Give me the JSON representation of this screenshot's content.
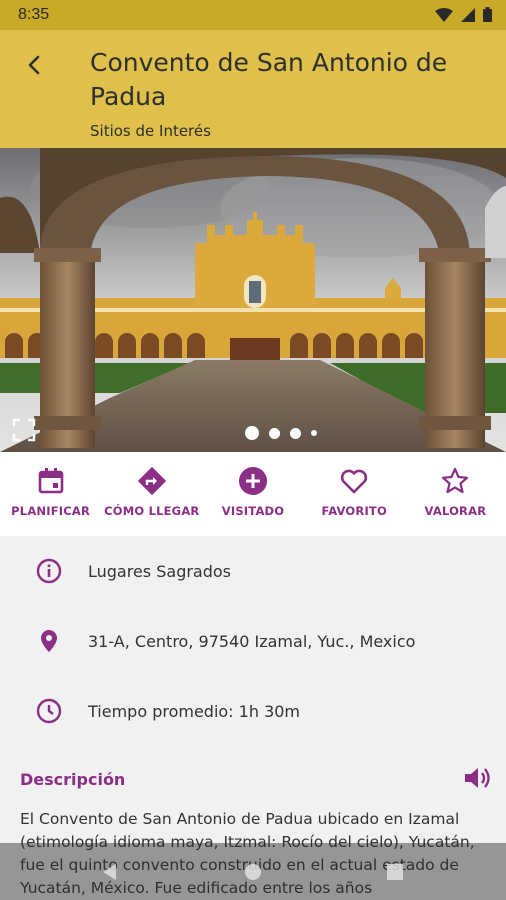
{
  "status_bar": {
    "time": "8:35"
  },
  "header": {
    "title": "Convento de San Antonio de Padua",
    "subtitle": "Sitios de Interés"
  },
  "gallery": {
    "pages": 4,
    "current_page": 1
  },
  "actions": [
    {
      "label": "PLANIFICAR",
      "icon": "calendar-icon"
    },
    {
      "label": "CÓMO LLEGAR",
      "icon": "directions-icon"
    },
    {
      "label": "VISITADO",
      "icon": "add-circle-icon"
    },
    {
      "label": "FAVORITO",
      "icon": "heart-icon"
    },
    {
      "label": "VALORAR",
      "icon": "star-icon"
    }
  ],
  "info": {
    "category": "Lugares Sagrados",
    "address": "31-A, Centro, 97540 Izamal, Yuc., Mexico",
    "duration": "Tiempo promedio: 1h 30m"
  },
  "description": {
    "title": "Descripción",
    "text": "El Convento de San Antonio de Padua ubicado en Izamal (etimología idioma maya, Itzmal: Rocío del cielo), Yucatán, fue el quinto convento construido en el actual estado de Yucatán, México. Fue edificado entre los años"
  },
  "colors": {
    "accent": "#8b2f86",
    "header": "#dec04a",
    "status_bar": "#c9a928"
  }
}
